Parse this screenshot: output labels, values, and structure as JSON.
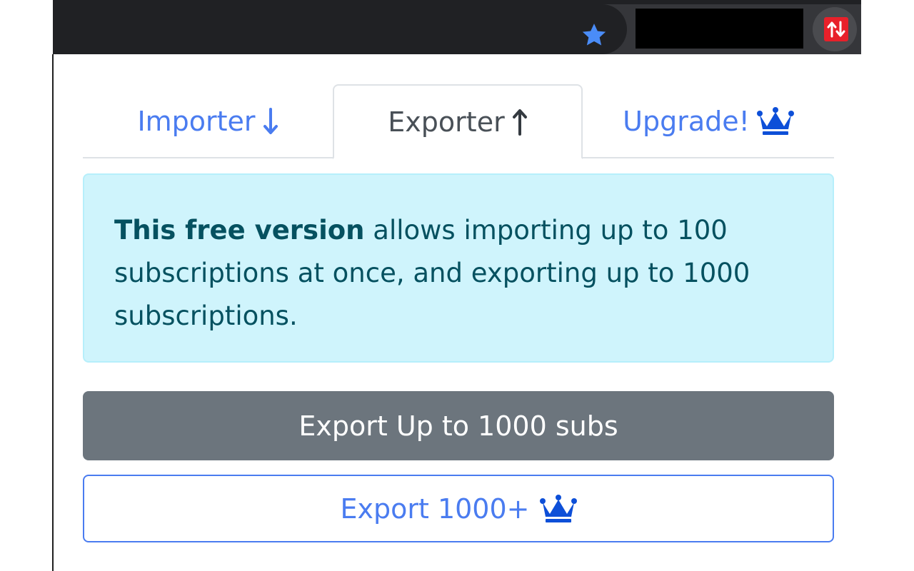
{
  "tabs": {
    "importer": {
      "label": "Importer",
      "icon": "arrow-down-icon"
    },
    "exporter": {
      "label": "Exporter",
      "icon": "arrow-up-icon",
      "active": true
    },
    "upgrade": {
      "label": "Upgrade!",
      "icon": "crown-icon"
    }
  },
  "alert": {
    "bold_text": "This free version",
    "text": " allows importing up to 100 subscriptions at once, and exporting up to 1000 subscriptions."
  },
  "buttons": {
    "export_free": "Export Up to 1000 subs",
    "export_premium": "Export 1000+"
  },
  "colors": {
    "accent": "#4a7cf0",
    "alert_bg": "#cff4fc",
    "alert_text": "#055160",
    "secondary_button": "#6c757d",
    "extension_icon": "#e8202a",
    "bookmark_star": "#4a8cf7"
  },
  "toolbar": {
    "bookmark_icon": "star-icon",
    "extension_icon": "import-export-arrows-icon"
  }
}
